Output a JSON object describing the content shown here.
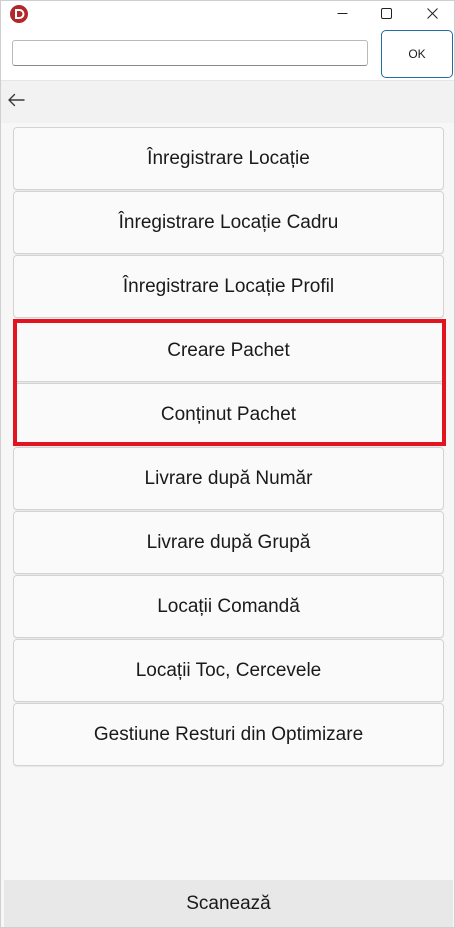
{
  "window": {
    "minimize_label": "",
    "maximize_label": "",
    "close_label": ""
  },
  "toolbar": {
    "input_value": "",
    "ok_label": "OK"
  },
  "menu": {
    "items": [
      {
        "label": "Înregistrare Locație"
      },
      {
        "label": "Înregistrare Locație Cadru"
      },
      {
        "label": "Înregistrare Locație Profil"
      },
      {
        "label": "Creare Pachet"
      },
      {
        "label": "Conținut Pachet"
      },
      {
        "label": "Livrare după Număr"
      },
      {
        "label": "Livrare după Grupă"
      },
      {
        "label": "Locații Comandă"
      },
      {
        "label": "Locații Toc, Cercevele"
      },
      {
        "label": "Gestiune Resturi din Optimizare"
      }
    ]
  },
  "bottom": {
    "scan_label": "Scanează"
  },
  "icons": {
    "app": "app-logo-icon",
    "minimize": "minimize-icon",
    "maximize": "maximize-icon",
    "close": "close-icon",
    "back": "back-arrow-icon"
  },
  "colors": {
    "highlight": "#e1141f",
    "ok_border": "#1f6e9f",
    "logo": "#b3262b"
  }
}
